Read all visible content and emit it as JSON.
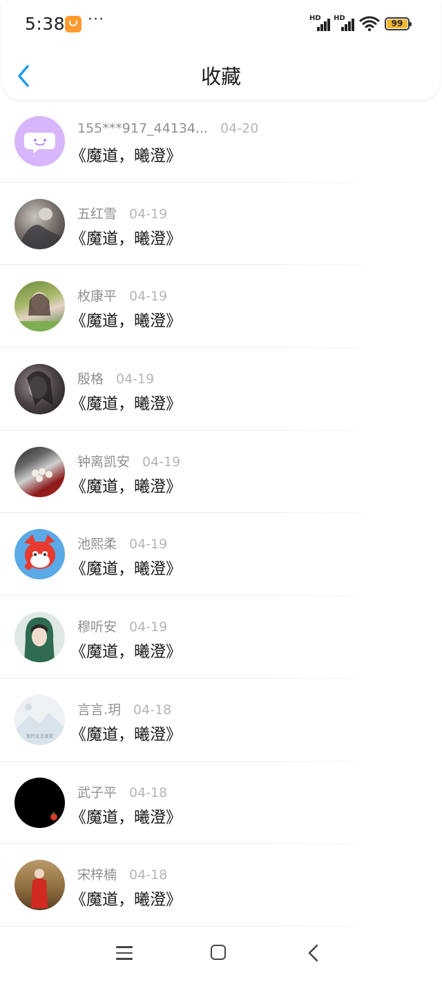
{
  "status_bar": {
    "time": "5:38",
    "more": "···",
    "network_label": "HD",
    "battery": "99"
  },
  "header": {
    "title": "收藏"
  },
  "items": [
    {
      "name": "155***917_44134...",
      "date": "04-20",
      "title": "《魔道，曦澄》",
      "avatar": "chat-bubble-avatar"
    },
    {
      "name": "五红雪",
      "date": "04-19",
      "title": "《魔道，曦澄》",
      "avatar": "photo-avatar"
    },
    {
      "name": "枚康平",
      "date": "04-19",
      "title": "《魔道，曦澄》",
      "avatar": "photo-avatar"
    },
    {
      "name": "殷格",
      "date": "04-19",
      "title": "《魔道，曦澄》",
      "avatar": "photo-avatar"
    },
    {
      "name": "钟离凯安",
      "date": "04-19",
      "title": "《魔道，曦澄》",
      "avatar": "photo-avatar"
    },
    {
      "name": "池熙柔",
      "date": "04-19",
      "title": "《魔道，曦澄》",
      "avatar": "cartoon-fox-avatar"
    },
    {
      "name": "穆听安",
      "date": "04-19",
      "title": "《魔道，曦澄》",
      "avatar": "illustration-avatar"
    },
    {
      "name": "言言.玥",
      "date": "04-18",
      "title": "《魔道，曦澄》",
      "avatar": "placeholder-image-avatar",
      "avatar_text": "暂时无法查看"
    },
    {
      "name": "武子平",
      "date": "04-18",
      "title": "《魔道，曦澄》",
      "avatar": "black-avatar"
    },
    {
      "name": "宋梓楠",
      "date": "04-18",
      "title": "《魔道，曦澄》",
      "avatar": "photo-avatar"
    }
  ],
  "colors": {
    "accent": "#1e9af0",
    "name_text": "#8f8f8f",
    "date_text": "#b5b5b5",
    "title_text": "#1a1a1a",
    "battery": "#f5b731",
    "chat_avatar": "#d7b6fb"
  },
  "nav_bar": {
    "icons": [
      "menu-icon",
      "home-icon",
      "back-icon"
    ]
  }
}
